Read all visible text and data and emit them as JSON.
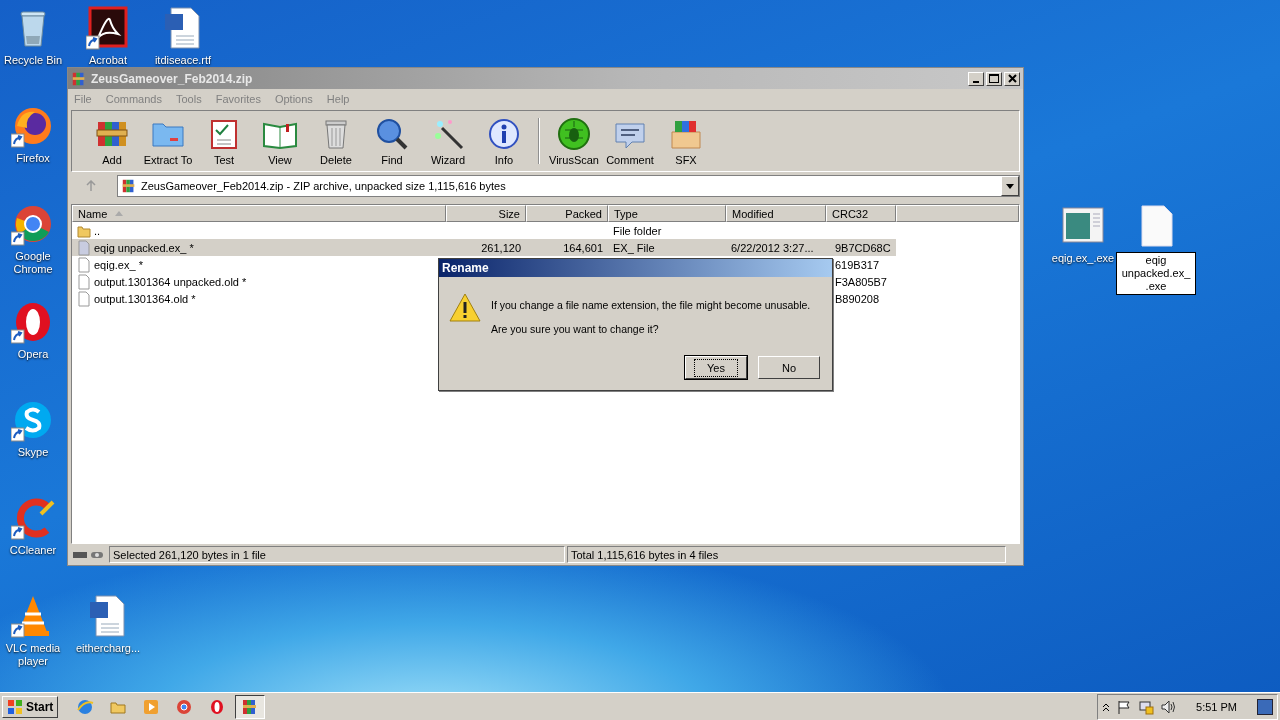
{
  "desktop_icons": [
    {
      "label": "Recycle Bin",
      "shortcut": false,
      "selected": false
    },
    {
      "label": "Acrobat",
      "shortcut": true,
      "selected": false
    },
    {
      "label": "itdiseace.rtf",
      "shortcut": false,
      "selected": false
    },
    {
      "label": "Firefox",
      "shortcut": true,
      "selected": false
    },
    {
      "label": "Google Chrome",
      "shortcut": true,
      "selected": false
    },
    {
      "label": "Opera",
      "shortcut": true,
      "selected": false
    },
    {
      "label": "Skype",
      "shortcut": true,
      "selected": false
    },
    {
      "label": "CCleaner",
      "shortcut": true,
      "selected": false
    },
    {
      "label": "VLC media player",
      "shortcut": true,
      "selected": false
    },
    {
      "label": "eithercharg...",
      "shortcut": false,
      "selected": false
    },
    {
      "label": "eqig.ex_.exe",
      "shortcut": false,
      "selected": false
    },
    {
      "label": "eqig unpacked.ex_ .exe",
      "shortcut": false,
      "selected": true
    }
  ],
  "window": {
    "title": "ZeusGameover_Feb2014.zip",
    "menu": [
      "File",
      "Commands",
      "Tools",
      "Favorites",
      "Options",
      "Help"
    ],
    "toolbar": [
      [
        "Add",
        "Extract To",
        "Test",
        "View",
        "Delete",
        "Find",
        "Wizard",
        "Info"
      ],
      [
        "VirusScan",
        "Comment",
        "SFX"
      ]
    ],
    "path": "ZeusGameover_Feb2014.zip - ZIP archive, unpacked size 1,115,616 bytes",
    "columns": [
      {
        "label": "Name",
        "sorted": true
      },
      {
        "label": "Size",
        "sorted": false
      },
      {
        "label": "Packed",
        "sorted": false
      },
      {
        "label": "Type",
        "sorted": false
      },
      {
        "label": "Modified",
        "sorted": false
      },
      {
        "label": "CRC32",
        "sorted": false
      }
    ],
    "rows": [
      {
        "kind": "folder",
        "name": "..",
        "type": "File folder",
        "selected": false
      },
      {
        "kind": "file",
        "name": "eqig unpacked.ex_ *",
        "size": "261,120",
        "packed": "164,601",
        "type": "EX_ File",
        "modified": "6/22/2012 3:27...",
        "crc": "9B7CD68C",
        "selected": true
      },
      {
        "kind": "file",
        "name": "eqig.ex_ *",
        "crc": "619B317",
        "selected": false
      },
      {
        "kind": "file",
        "name": "output.1301364 unpacked.old *",
        "crc": "F3A805B7",
        "selected": false
      },
      {
        "kind": "file",
        "name": "output.1301364.old *",
        "crc": "B890208",
        "selected": false
      }
    ],
    "status": [
      "Selected 261,120 bytes in 1 file",
      "Total 1,115,616 bytes in 4 files"
    ]
  },
  "dialog": {
    "title": "Rename",
    "message": "If you change a file name extension, the file might become unusable.",
    "question": "Are you sure you want to change it?",
    "buttons": [
      {
        "label": "Yes",
        "default": true
      },
      {
        "label": "No",
        "default": false
      }
    ]
  },
  "taskbar": {
    "start": "Start",
    "apps": [
      {
        "selected": false
      },
      {
        "selected": false
      },
      {
        "selected": false
      },
      {
        "selected": false
      },
      {
        "selected": false
      },
      {
        "selected": true
      }
    ],
    "clock": "5:51 PM"
  }
}
